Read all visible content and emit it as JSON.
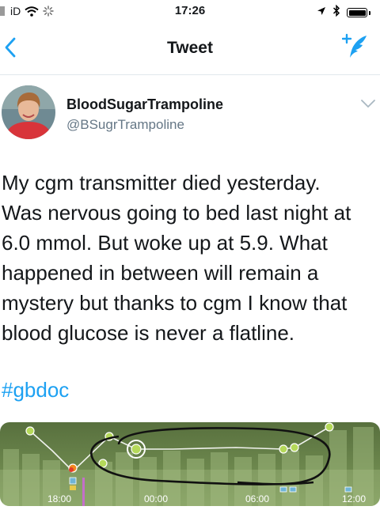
{
  "status_bar": {
    "carrier": "iD",
    "time": "17:26"
  },
  "nav": {
    "title": "Tweet"
  },
  "author": {
    "display_name": "BloodSugarTrampoline",
    "handle": "@BSugrTrampoline"
  },
  "tweet": {
    "lines": [
      "My cgm transmitter died yesterday.",
      "Was nervous going to bed last night at",
      "6.0 mmol. But woke up at 5.9. What",
      "happened in between will remain a",
      "mystery but thanks to cgm I know that",
      "blood glucose is never a flatline."
    ],
    "hashtag": "#gbdoc"
  },
  "cgm_chart": {
    "time_labels": [
      "18:00",
      "00:00",
      "06:00",
      "12:00"
    ]
  },
  "colors": {
    "link_blue": "#1da1f2",
    "chart_green": "#6e8f4c",
    "point_green": "#b5d95a"
  }
}
